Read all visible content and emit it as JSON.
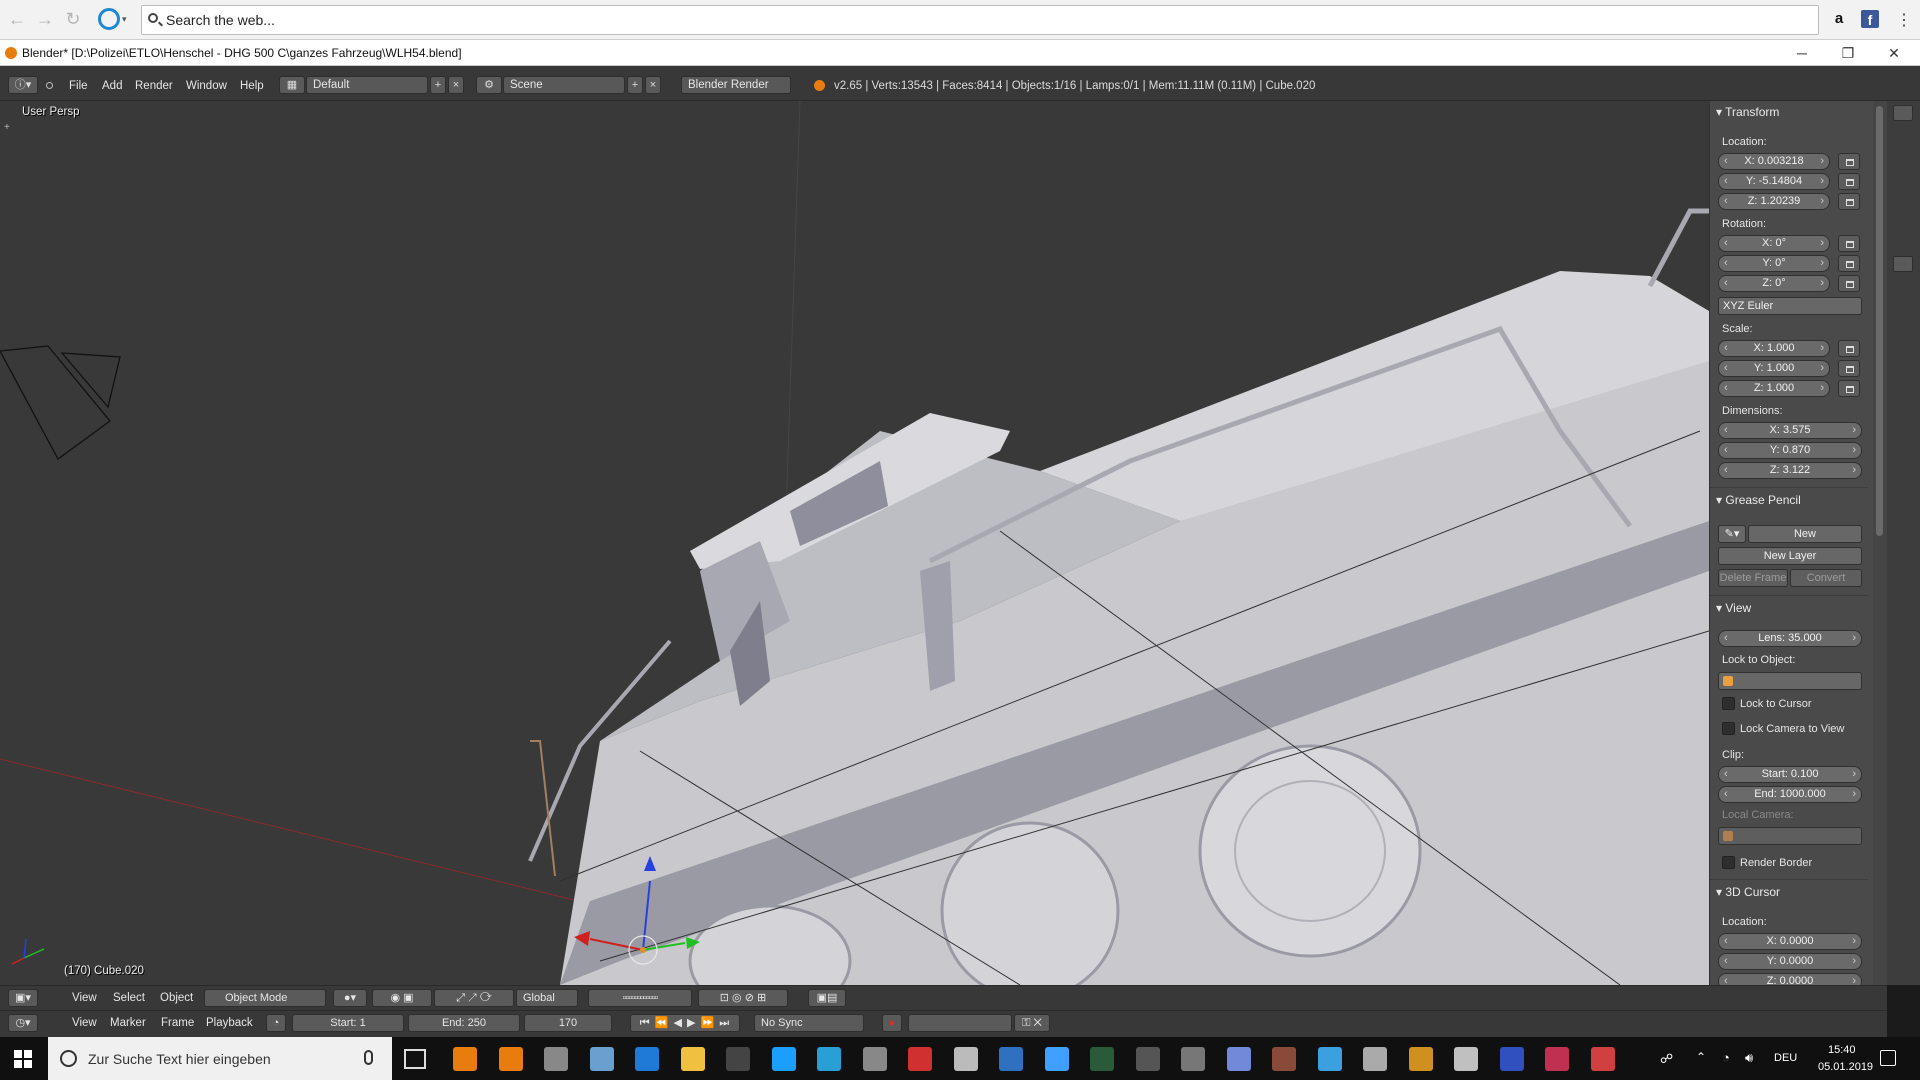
{
  "browser": {
    "search_placeholder": "Search the web...",
    "colors": {
      "amazon": "#111111",
      "facebook": "#3b5998"
    }
  },
  "window": {
    "title": "Blender* [D:\\Polizei\\ETLO\\Henschel - DHG 500 C\\ganzes Fahrzeug\\WLH54.blend]",
    "controls": [
      "─",
      "❐",
      "✕"
    ]
  },
  "blender_header": {
    "menus": [
      "File",
      "Add",
      "Render",
      "Window",
      "Help"
    ],
    "screen_layout": "Default",
    "scene": "Scene",
    "render_engine": "Blender Render",
    "stats": "v2.65 | Verts:13543 | Faces:8414 | Objects:1/16 | Lamps:0/1 | Mem:11.11M (0.11M) | Cube.020"
  },
  "viewport": {
    "view_label": "User Persp",
    "object_label": "(170) Cube.020",
    "colors": {
      "background": "#393939",
      "model": "#c8c8cc",
      "x_axis": "#b03030",
      "y_axis": "#4a9a30",
      "z_axis": "#3050d0"
    }
  },
  "npanel": {
    "transform": {
      "title": "Transform",
      "location_label": "Location:",
      "location": [
        "X: 0.003218",
        "Y: -5.14804",
        "Z: 1.20239"
      ],
      "rotation_label": "Rotation:",
      "rotation": [
        "X: 0°",
        "Y: 0°",
        "Z: 0°"
      ],
      "rotation_mode": "XYZ Euler",
      "scale_label": "Scale:",
      "scale": [
        "X: 1.000",
        "Y: 1.000",
        "Z: 1.000"
      ],
      "dimensions_label": "Dimensions:",
      "dimensions": [
        "X: 3.575",
        "Y: 0.870",
        "Z: 3.122"
      ]
    },
    "grease_pencil": {
      "title": "Grease Pencil",
      "new": "New",
      "new_layer": "New Layer",
      "delete_frame": "Delete Frame",
      "convert": "Convert"
    },
    "view": {
      "title": "View",
      "lens": "Lens: 35.000",
      "lock_to_object_label": "Lock to Object:",
      "lock_to_cursor": "Lock to Cursor",
      "lock_camera_to_view": "Lock Camera to View",
      "clip_label": "Clip:",
      "clip_start": "Start: 0.100",
      "clip_end": "End: 1000.000",
      "local_camera_label": "Local Camera:",
      "render_border": "Render Border"
    },
    "cursor": {
      "title": "3D Cursor",
      "location_label": "Location:",
      "location": [
        "X: 0.0000",
        "Y: 0.0000",
        "Z: 0.0000"
      ]
    }
  },
  "view3d_header": {
    "menus": [
      "View",
      "Select",
      "Object"
    ],
    "mode": "Object Mode",
    "orientation": "Global"
  },
  "timeline_header": {
    "menus": [
      "View",
      "Marker",
      "Frame",
      "Playback"
    ],
    "start": "Start: 1",
    "end": "End: 250",
    "current": "170",
    "sync": "No Sync"
  },
  "taskbar": {
    "search_placeholder": "Zur Suche Text hier eingeben",
    "language": "DEU",
    "time": "15:40",
    "date": "05.01.2019",
    "app_icon_colors": [
      "#e87d0d",
      "#e87d0d",
      "#888888",
      "#6aa0d0",
      "#1e7ad6",
      "#f0c040",
      "#444444",
      "#1a9fff",
      "#2a9fd6",
      "#888888",
      "#d03030",
      "#bbbbbb",
      "#3070c0",
      "#40a0ff",
      "#2a5a3a",
      "#555555",
      "#777777",
      "#7289da",
      "#8a4a3a",
      "#3aa0e0",
      "#aaaaaa",
      "#d09020",
      "#c0c0c0",
      "#3050c0",
      "#c03050",
      "#d04040"
    ]
  }
}
